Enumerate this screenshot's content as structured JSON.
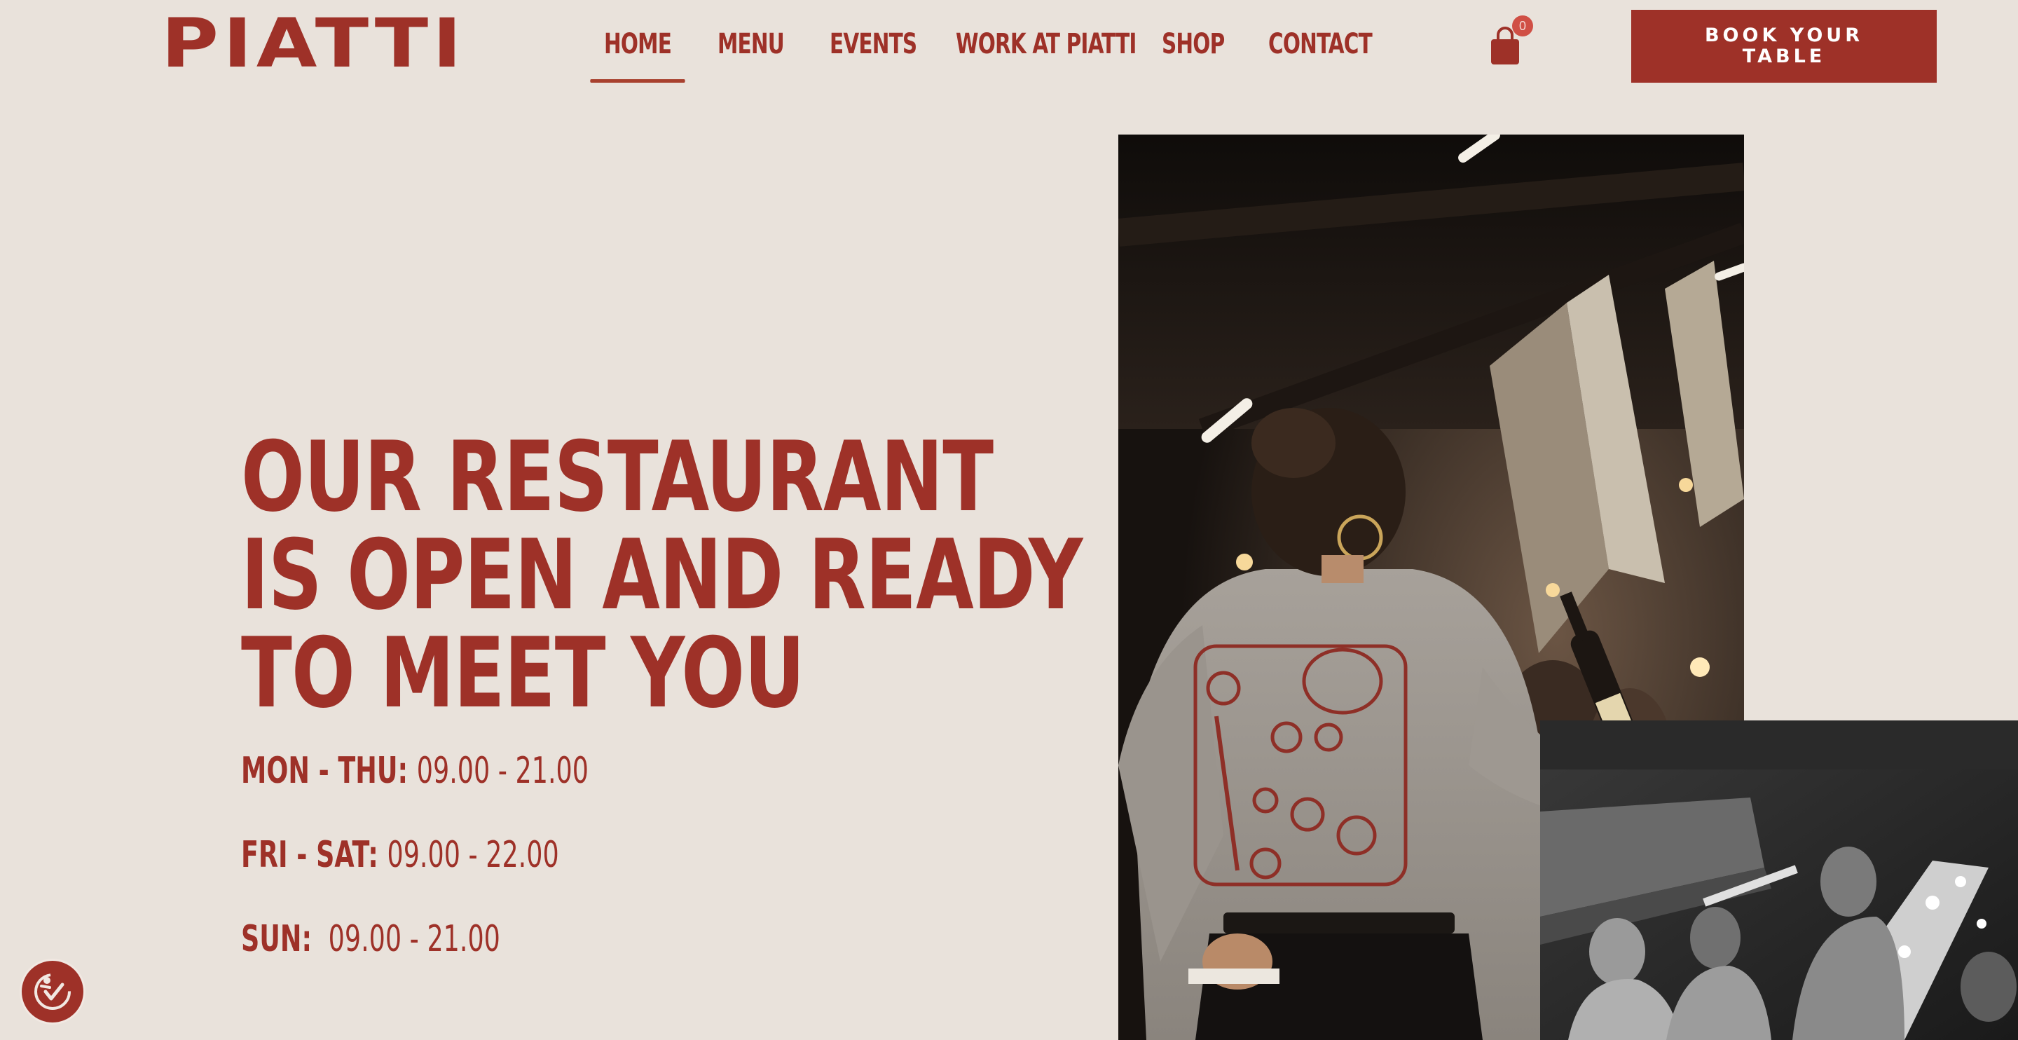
{
  "brand": {
    "logo_text": "PIATTI"
  },
  "nav": {
    "items": [
      {
        "label": "HOME",
        "active": true
      },
      {
        "label": "MENU"
      },
      {
        "label": "EVENTS"
      },
      {
        "label": "WORK AT PIATTI"
      },
      {
        "label": "SHOP"
      },
      {
        "label": "CONTACT"
      }
    ]
  },
  "cart": {
    "count": "0",
    "icon": "shopping-bag-icon"
  },
  "cta": {
    "book_label": "BOOK YOUR TABLE"
  },
  "hero": {
    "headline_lines": [
      "OUR RESTAURANT",
      "IS OPEN AND READY",
      "TO MEET YOU"
    ],
    "hours": [
      {
        "days": "MON - THU:",
        "time": "09.00 - 21.00"
      },
      {
        "days": "FRI - SAT:",
        "time": "09.00 - 22.00"
      },
      {
        "days": "SUN:",
        "time": "09.00 - 21.00"
      }
    ]
  },
  "accessibility": {
    "icon": "accessibility-icon"
  },
  "colors": {
    "background": "#e9e2db",
    "brand_red": "#9e3128",
    "badge": "#d04f45"
  }
}
